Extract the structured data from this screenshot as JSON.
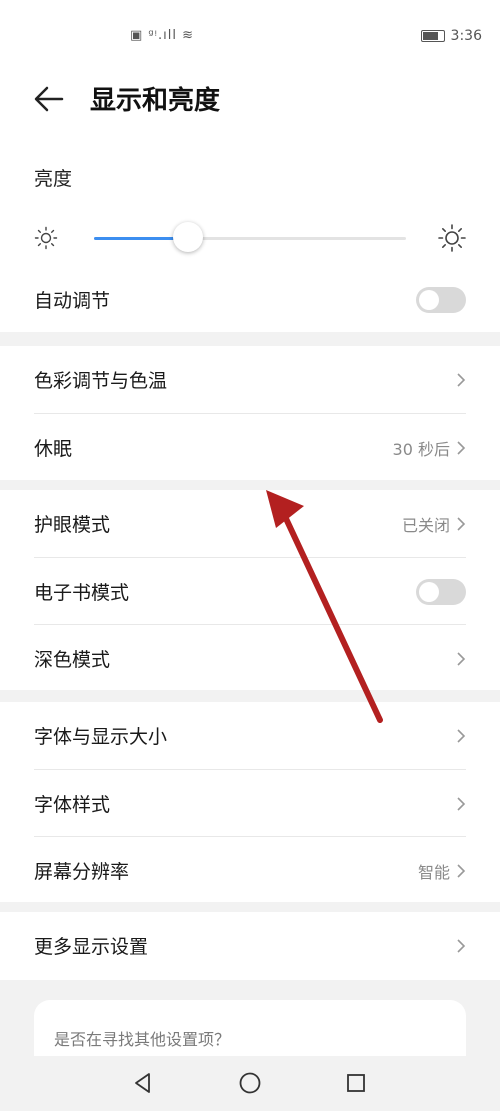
{
  "status_bar": {
    "center_icons": "▣ ᵍᵎ.ıll ≋",
    "time": "3:36",
    "battery_level": 0.7
  },
  "header": {
    "back_icon": "back-arrow-icon",
    "title": "显示和亮度"
  },
  "brightness": {
    "label": "亮度",
    "level": 0.3,
    "accent_color": "#3c8ef0",
    "auto_label": "自动调节",
    "auto_enabled": false
  },
  "sections": [
    {
      "items": [
        {
          "label": "色彩调节与色温",
          "value": ""
        },
        {
          "label": "休眠",
          "value": "30 秒后"
        }
      ]
    },
    {
      "items": [
        {
          "label": "护眼模式",
          "value": "已关闭"
        },
        {
          "label": "电子书模式",
          "toggle": false
        },
        {
          "label": "深色模式",
          "value": ""
        }
      ]
    },
    {
      "items": [
        {
          "label": "字体与显示大小",
          "value": ""
        },
        {
          "label": "字体样式",
          "value": ""
        },
        {
          "label": "屏幕分辨率",
          "value": "智能"
        }
      ]
    },
    {
      "items": [
        {
          "label": "更多显示设置",
          "value": ""
        }
      ]
    }
  ],
  "search_prompt": "是否在寻找其他设置项？",
  "annotation_color": "#b32020"
}
